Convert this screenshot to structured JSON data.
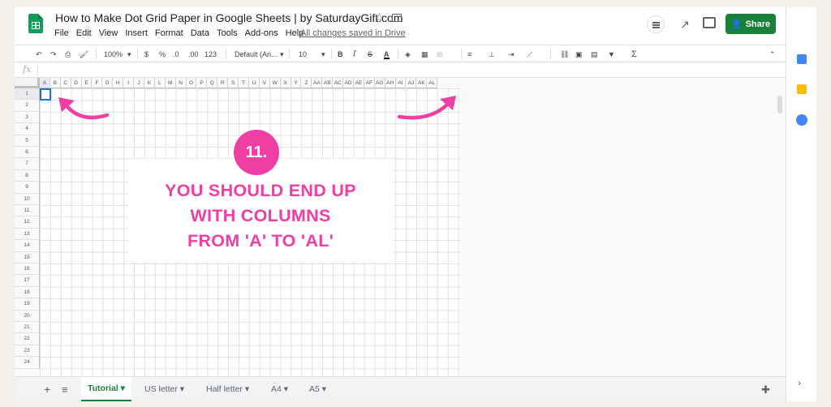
{
  "app": {
    "doc_title": "How to Make Dot Grid Paper in Google Sheets | by SaturdayGift.com",
    "saved_status": "All changes saved in Drive"
  },
  "menu": [
    "File",
    "Edit",
    "View",
    "Insert",
    "Format",
    "Data",
    "Tools",
    "Add-ons",
    "Help"
  ],
  "share": {
    "label": "Share"
  },
  "toolbar": {
    "zoom": "100%",
    "currency": "$",
    "percent": "%",
    "dec_dec": ".0",
    "dec_inc": ".00",
    "more_formats": "123",
    "font": "Default (Ari...",
    "font_size": "10",
    "bold": "B",
    "italic": "I",
    "strike": "S",
    "text_color": "A",
    "sigma": "Σ"
  },
  "formula_bar": {
    "fx": "fx",
    "value": ""
  },
  "columns": [
    "A",
    "B",
    "C",
    "D",
    "E",
    "F",
    "G",
    "H",
    "I",
    "J",
    "K",
    "L",
    "M",
    "N",
    "O",
    "P",
    "Q",
    "R",
    "S",
    "T",
    "U",
    "V",
    "W",
    "X",
    "Y",
    "Z",
    "AA",
    "AB",
    "AC",
    "AD",
    "AE",
    "AF",
    "AG",
    "AH",
    "AI",
    "AJ",
    "AK",
    "AL"
  ],
  "rows": [
    "1",
    "2",
    "3",
    "4",
    "5",
    "6",
    "7",
    "8",
    "9",
    "10",
    "11",
    "12",
    "13",
    "14",
    "15",
    "16",
    "17",
    "18",
    "19",
    "20",
    "21",
    "22",
    "23",
    "24"
  ],
  "overlay": {
    "step": "11.",
    "line1": "YOU SHOULD END UP",
    "line2": "WITH COLUMNS",
    "line3": "FROM 'A' TO 'AL'",
    "accent": "#ef3ea4"
  },
  "sheets": {
    "add": "+",
    "list": "≡",
    "tabs": [
      "Tutorial",
      "US letter",
      "Half letter",
      "A4",
      "A5"
    ],
    "active": "Tutorial"
  },
  "colors": {
    "brand_green": "#188038",
    "sheets_green": "#0f9d58",
    "selection_blue": "#1a73e8",
    "background": "#f3efe9"
  }
}
